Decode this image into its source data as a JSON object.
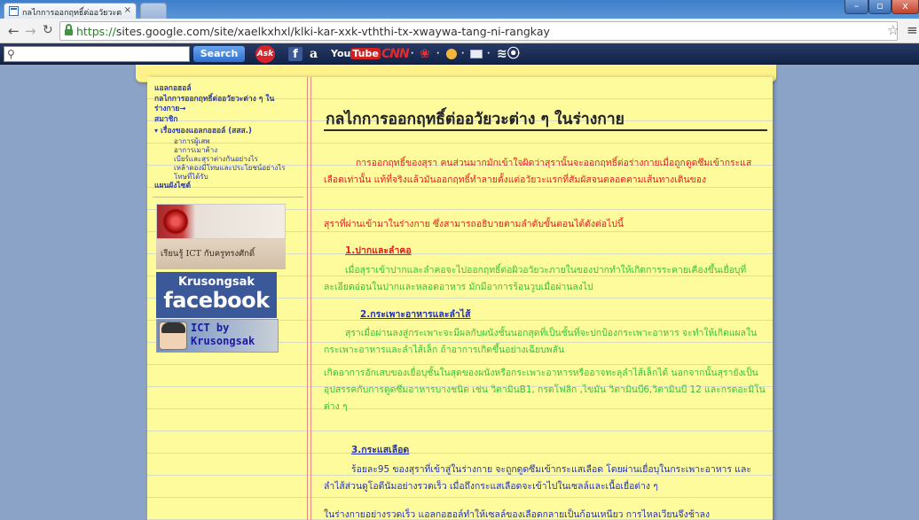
{
  "browser": {
    "tab_title": "กลไกการออกฤทธิ์ต่ออวัยวะต",
    "tab_close": "×",
    "url_scheme": "https://",
    "url_rest": "sites.google.com/site/xaelkxhxl/klki-kar-xxk-vththi-tx-xwaywa-tang-ni-rangkay",
    "window_minimize": "–",
    "window_maximize": "▫",
    "window_close": "x"
  },
  "toolbar": {
    "search_button": "Search",
    "ask_label": "Ask",
    "facebook_label": "f",
    "amazon_label": "a",
    "youtube_you": "You",
    "youtube_tube": "Tube",
    "cnn_label": "CNN",
    "dropdown_mark": "·",
    "speech_label": "≋⦿"
  },
  "sidebar": {
    "items": [
      {
        "label": "แอลกอฮอล์"
      },
      {
        "label": "กลไกการออกฤทธิ์ต่ออวัยวะต่าง ๆ ใน ร่างกาย"
      },
      {
        "label": "สมาชิก"
      },
      {
        "label": "เรื่องของแอลกอฮอล์ (สสส.)"
      },
      {
        "label": "แผนผังไซต์"
      }
    ],
    "current_marker": "→",
    "expand_marker": "▾",
    "subitems": [
      {
        "label": "อาการผู้เสพ"
      },
      {
        "label": "อาการเมาค้าง"
      },
      {
        "label": "เบียร์และสุราต่างกันอย่างไร"
      },
      {
        "label": "เหล้าดองมีโทษและประโยชน์อย่างไร"
      },
      {
        "label": "โทษที่ได้รับ"
      }
    ],
    "ict_banner_text": "เรียนรู้ ICT กับครูทรงศักดิ์",
    "facebook_name": "Krusongsak",
    "facebook_word": "facebook",
    "ictby_line1": "ICT by",
    "ictby_line2": "Krusongsak"
  },
  "content": {
    "title": "กลไกการออกฤทธิ์ต่ออวัยวะต่าง ๆ ในร่างกาย",
    "intro": "การออกฤทธิ์ของสุรา คนส่วนมากมักเข้าใจผิดว่าสุรานั้นจะออกฤทธิ์ต่อร่างกายเมื่อถูกดูดซึมเข้ากระแสเลือดเท่านั้น แท้ที่จริงแล้วมันออกฤทธิ์ทำลายตั้งแต่อวัยวะแรกที่สัมผัสจนตลอดตามเส้นทางเดินของ",
    "lead": "สุราที่ผ่านเข้ามาในร่างกาย ซึ่งสามารถอธิบายตามลำดับขั้นตอนได้ดังต่อไปนี้",
    "section1_heading": "1.ปากและลำคอ",
    "section1_text": "เมื่อสุราเข้าปากและลำคอจะไปออกฤทธิ์ต่อผิวอวัยวะภายในของปากทำให้เกิดการระคายเคืองขึ้นเยื่อบุที่ละเอียดอ่อนในปากและหลอดอาหาร มักมีอาการร้อนวูบเมื่อผ่านลงไป",
    "section2_heading": "2.กระเพาะอาหารและลำไส้",
    "section2_text": "สุราเมื่อผ่านลงสู่กระเพาะจะมีผลกับผนังชั้นนอกสุดที่เป็นชั้นที่จะปกป้องกระเพาะอาหาร จะทำให้เกิดแผลในกระเพาะอาหารและลำไส้เล็ก ถ้าอาการเกิดขึ้นอย่างเฉียบพลัน",
    "section2_text2": "เกิดอาการอักเสบของเยื่อบุชั้นในสุดของผนังหรือกระเพาะอาหารหรืออาจทะลุลำไส้เล็กได้ นอกจากนั้นสุรายังเป็นอุปสรรคกับการดูดซึมอาหารบางชนิด เช่น วิตามินB1, กรดโฟลิก ,ไขมัน วิตามินบี6,วิตามินบี 12 และกรดอะมิโนต่าง ๆ",
    "section3_heading": "3.กระแสเลือด",
    "section3_text": "ร้อยละ95 ของสุราที่เข้าสู่ในร่างกาย จะถูกดูดซึมเข้ากระแสเลือด โดยผ่านเยื่อบุในกระเพาะอาหาร และลำไส้ส่วนดูโอดีนัมอย่างรวดเร็ว เมื่อถึงกระแสเลือดจะเข้าไปในเซลล์และเนื้อเยื่อต่าง ๆ",
    "section3_partial": "ในร่างกายอย่างรวดเร็ว แอลกอฮอล์ทำให้เซลล์ของเลือดกลายเป็นก้อนเหนียว การไหลเวียนจึงช้าลง"
  },
  "colors": {
    "paper": "#fefb9c",
    "red_text": "#e02020",
    "green_text": "#38c238",
    "blue_text": "#2333b0",
    "page_bg": "#8aa3c7"
  }
}
